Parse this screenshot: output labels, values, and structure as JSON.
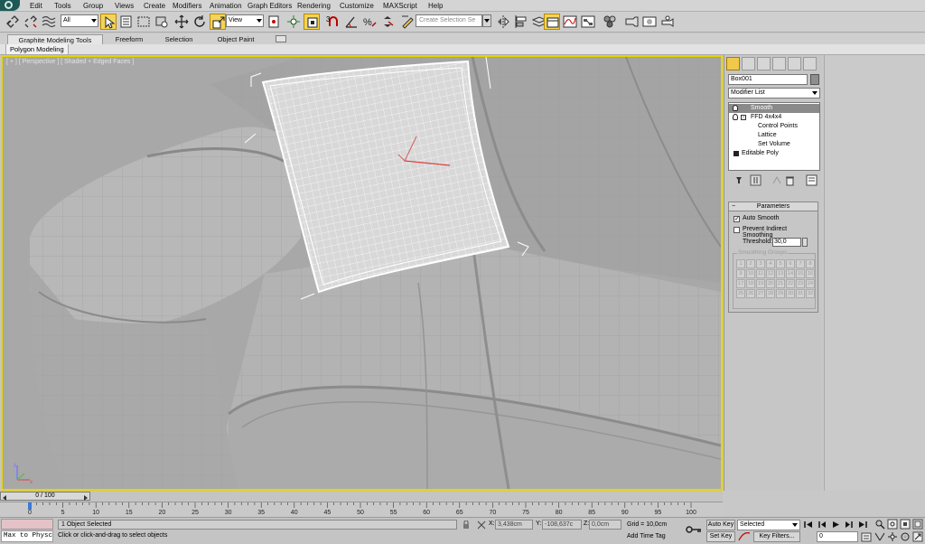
{
  "menu": [
    "Edit",
    "Tools",
    "Group",
    "Views",
    "Create",
    "Modifiers",
    "Animation",
    "Graph Editors",
    "Rendering",
    "Customize",
    "MAXScript",
    "Help"
  ],
  "toolbar": {
    "selection_filter": "All",
    "ref_coord": "View",
    "named_selection_placeholder": "Create Selection Se",
    "snap_value": "3",
    "icons": [
      "undo-icon",
      "redo-icon",
      "link-icon",
      "unlink-icon",
      "bind-spacewarp-icon",
      "select-object-icon",
      "rectangular-region-icon",
      "window-crossing-icon",
      "select-move-icon",
      "select-rotate-icon",
      "select-scale-icon",
      "pivot-center-icon",
      "select-manipulate-icon",
      "snap-toggle-icon",
      "angle-snap-icon",
      "percent-snap-icon",
      "spinner-snap-icon",
      "edit-named-selection-icon",
      "mirror-icon",
      "align-icon",
      "layer-manager-icon",
      "graphite-toggle-icon",
      "curve-editor-icon",
      "schematic-view-icon",
      "material-editor-icon",
      "render-setup-icon",
      "rendered-frame-icon",
      "render-icon"
    ]
  },
  "ribbon": {
    "tabs": [
      "Graphite Modeling Tools",
      "Freeform",
      "Selection",
      "Object Paint"
    ],
    "sub_tab": "Polygon Modeling"
  },
  "viewport": {
    "label": "[ + ] [ Perspective ] [ Shaded + Edged Faces ]"
  },
  "command_panel": {
    "object_name": "Box001",
    "object_color": "#8e8e8e",
    "modifier_list_label": "Modifier List",
    "stack": [
      {
        "label": "Smooth",
        "selected": true
      },
      {
        "label": "FFD 4x4x4",
        "selected": false
      },
      {
        "label": "Control Points",
        "selected": false
      },
      {
        "label": "Lattice",
        "selected": false
      },
      {
        "label": "Set Volume",
        "selected": false
      },
      {
        "label": "Editable Poly",
        "selected": false
      }
    ],
    "parameters": {
      "title": "Parameters",
      "auto_smooth_label": "Auto Smooth",
      "auto_smooth_checked": true,
      "prevent_label": "Prevent Indirect Smoothing",
      "prevent_checked": false,
      "threshold_label": "Threshold:",
      "threshold_value": "30,0",
      "smoothing_groups_label": "Smoothing Groups",
      "groups": [
        "1",
        "2",
        "3",
        "4",
        "5",
        "6",
        "7",
        "8",
        "9",
        "10",
        "11",
        "12",
        "13",
        "14",
        "15",
        "16",
        "17",
        "18",
        "19",
        "20",
        "21",
        "22",
        "23",
        "24",
        "25",
        "26",
        "27",
        "28",
        "29",
        "30",
        "31",
        "32"
      ]
    }
  },
  "time_slider": {
    "label": "0 / 100",
    "current_frame": 0,
    "total_frames": 100,
    "ticks": [
      "0",
      "5",
      "10",
      "15",
      "20",
      "25",
      "30",
      "35",
      "40",
      "45",
      "50",
      "55",
      "60",
      "65",
      "70",
      "75",
      "80",
      "85",
      "90",
      "95",
      "100"
    ]
  },
  "status": {
    "listener_text": "Max to Physc",
    "selected_text": "1 Object Selected",
    "prompt": "Click or click-and-drag to select objects",
    "x_label": "X:",
    "x_value": "3,438cm",
    "y_label": "Y:",
    "y_value": "-108,637c",
    "z_label": "Z:",
    "z_value": "0,0cm",
    "grid": "Grid = 10,0cm",
    "add_time_tag": "Add Time Tag",
    "auto_key": "Auto Key",
    "set_key": "Set Key",
    "key_mode": "Selected",
    "key_filters": "Key Filters...",
    "current_frame_field": "0"
  },
  "colors": {
    "viewport_border": "#e7d400",
    "active_button": "#f3d45a",
    "listener_bg": "#e5c2c7"
  }
}
